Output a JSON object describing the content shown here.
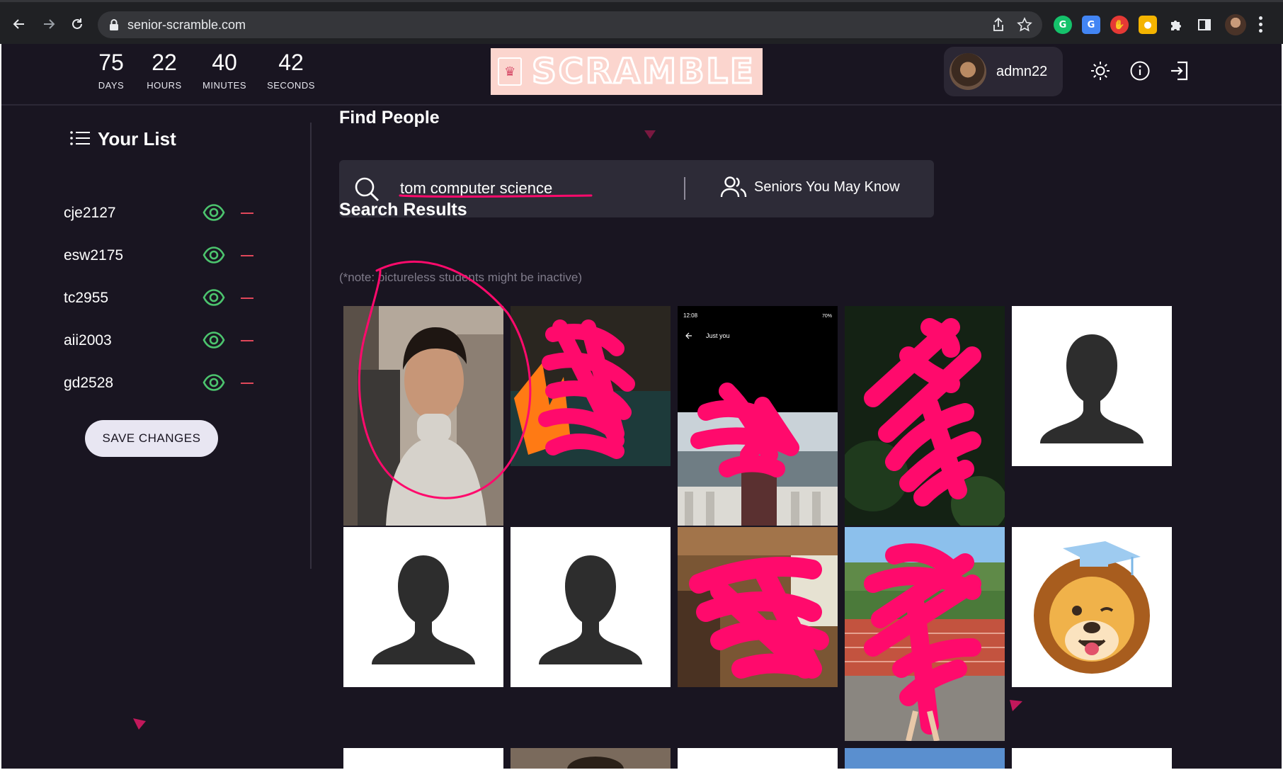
{
  "browser": {
    "url": "senior-scramble.com"
  },
  "countdown": [
    {
      "value": "75",
      "label": "DAYS"
    },
    {
      "value": "22",
      "label": "HOURS"
    },
    {
      "value": "40",
      "label": "MINUTES"
    },
    {
      "value": "42",
      "label": "SECONDS"
    }
  ],
  "logo": {
    "text": "SCRAMBLE"
  },
  "user": {
    "name": "admn22"
  },
  "sidebar": {
    "title": "Your List",
    "items": [
      {
        "name": "cje2127"
      },
      {
        "name": "esw2175"
      },
      {
        "name": "tc2955"
      },
      {
        "name": "aii2003"
      },
      {
        "name": "gd2528"
      }
    ],
    "save_label": "SAVE CHANGES"
  },
  "main": {
    "find_title": "Find People",
    "search_value": "tom computer science",
    "seniors_label": "Seniors You May Know",
    "results_title": "Search Results",
    "note": "(*note: pictureless students might be inactive)"
  },
  "phone_screenshot": {
    "time": "12:08",
    "battery": "70%",
    "title": "Just you"
  },
  "colors": {
    "app_bg": "#191521",
    "accent_green": "#4cc46e",
    "remove_red": "#e0475a",
    "scribble_pink": "#ff0a6c",
    "logo_bg": "#fbd5ce"
  }
}
